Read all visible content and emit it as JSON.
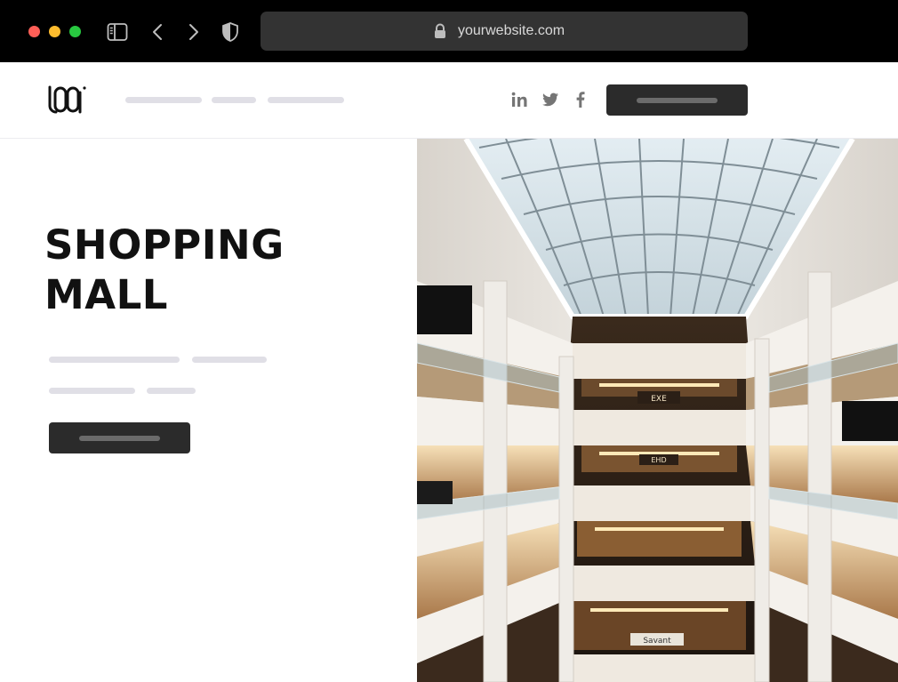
{
  "browser": {
    "url": "yourwebsite.com",
    "icons": [
      "close-dot",
      "minimize-dot",
      "maximize-dot",
      "sidebar-icon",
      "back-icon",
      "forward-icon",
      "shield-icon",
      "lock-icon"
    ]
  },
  "header": {
    "logo_text": "LOGO",
    "social": [
      "linkedin-icon",
      "twitter-icon",
      "facebook-icon"
    ]
  },
  "hero": {
    "title_line1": "SHOPPING",
    "title_line2": "MALL",
    "image": {
      "subject": "shopping-mall-atrium",
      "sign_texts": [
        "EXE",
        "EHD",
        "Savant"
      ]
    }
  },
  "colors": {
    "chrome_bg": "#000000",
    "urlbar_bg": "#333333",
    "button_dark": "#2b2b2b",
    "placeholder_line": "#e0dfe6",
    "close": "#ff5f57",
    "minimize": "#febc2e",
    "maximize": "#28c840"
  }
}
